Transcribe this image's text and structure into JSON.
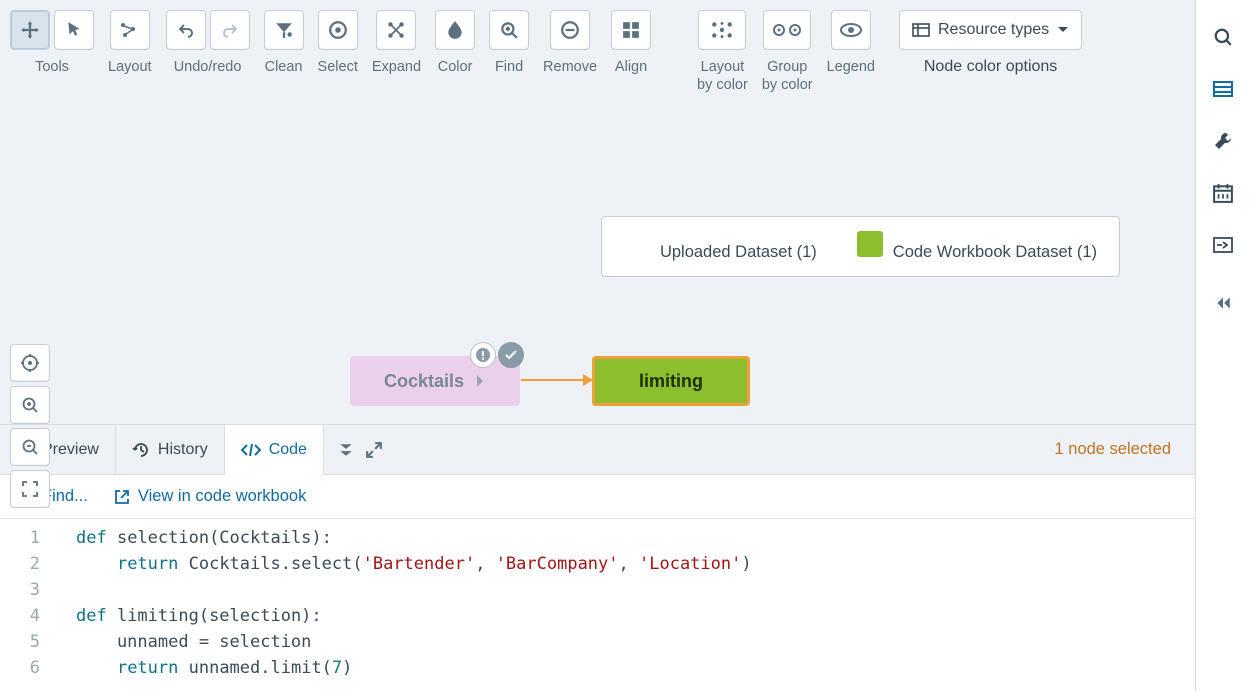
{
  "toolbar": {
    "tools_label": "Tools",
    "layout_label": "Layout",
    "undo_label": "Undo/redo",
    "clean_label": "Clean",
    "select_label": "Select",
    "expand_label": "Expand",
    "color_label": "Color",
    "find_label": "Find",
    "remove_label": "Remove",
    "align_label": "Align",
    "layout_by_color_label": "Layout\nby color",
    "group_by_color_label": "Group\nby color",
    "legend_label": "Legend",
    "resource_types_label": "Resource types",
    "node_color_options_label": "Node color options"
  },
  "legend": {
    "uploaded": {
      "label": "Uploaded Dataset (1)",
      "color": "#ead0ea"
    },
    "workbook": {
      "label": "Code Workbook Dataset (1)",
      "color": "#8bbf2d"
    }
  },
  "nodes": {
    "cocktails_label": "Cocktails",
    "limiting_label": "limiting"
  },
  "tabs": {
    "preview": "Preview",
    "history": "History",
    "code": "Code"
  },
  "status": {
    "selected": "1 node selected"
  },
  "panel_actions": {
    "find": "Find...",
    "view_workbook": "View in code workbook"
  },
  "code_lines": {
    "l1": "def selection(Cocktails):",
    "l2a": "    return Cocktails.select(",
    "l2s1": "'Bartender'",
    "l2s2": "'BarCompany'",
    "l2s3": "'Location'",
    "l4": "def limiting(selection):",
    "l5": "    unnamed = selection",
    "l6a": "    return unnamed.limit(",
    "l6n": "7"
  },
  "line_numbers": [
    "1",
    "2",
    "3",
    "4",
    "5",
    "6"
  ]
}
